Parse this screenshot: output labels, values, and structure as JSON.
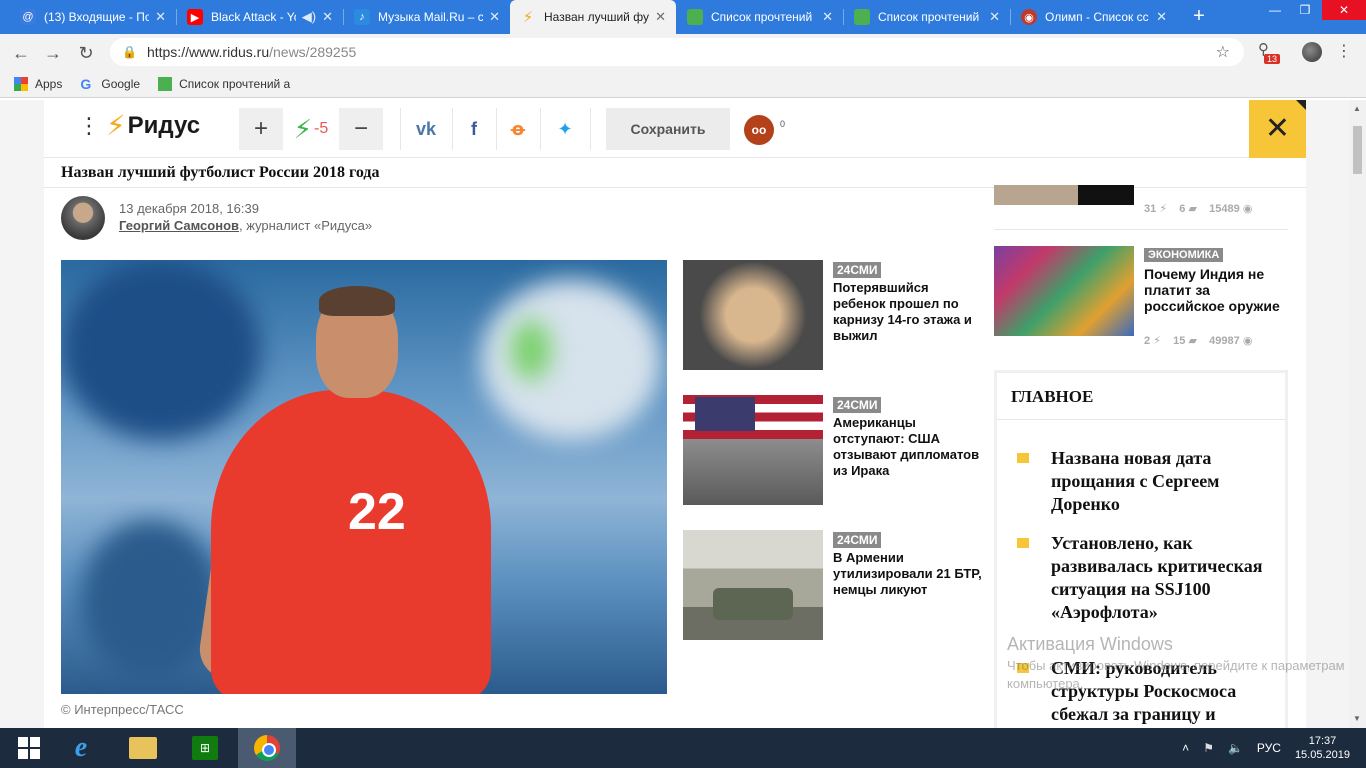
{
  "browser": {
    "tabs": [
      {
        "title": "(13) Входящие - По",
        "icon": "mail-ru-icon",
        "color": "#3a7be0",
        "active": false
      },
      {
        "title": "Black Attack - Yo",
        "icon": "youtube-icon",
        "color": "#ff0000",
        "active": false
      },
      {
        "title": "Музыка Mail.Ru – с",
        "icon": "mail-music-icon",
        "color": "#2a8be0",
        "active": false
      },
      {
        "title": "Назван лучший фу",
        "icon": "ridus-bolt-icon",
        "color": "#f7a81b",
        "active": true
      },
      {
        "title": "Список прочтений",
        "icon": "green-square-icon",
        "color": "#4caf50",
        "active": false
      },
      {
        "title": "Список прочтений",
        "icon": "green-square-icon",
        "color": "#4caf50",
        "active": false
      },
      {
        "title": "Олимп - Список сс",
        "icon": "olimp-icon",
        "color": "#c0392b",
        "active": false
      }
    ],
    "new_tab_label": "+",
    "window_controls": {
      "minimize": "—",
      "restore": "❐",
      "close": "✕"
    },
    "url_host": "https://www.ridus.ru",
    "url_path": "/news/289255",
    "extension_badge": "13",
    "bookmarks": [
      {
        "label": "Apps",
        "icon": "apps-grid-icon"
      },
      {
        "label": "Google",
        "icon": "google-icon"
      },
      {
        "label": "Список прочтений а",
        "icon": "green-square-icon"
      }
    ]
  },
  "site": {
    "logo_text": "Ридус",
    "rating_plus": "+",
    "rating_minus": "−",
    "rating_value": "-5",
    "share_vk": "vk",
    "share_fb": "f",
    "share_ok": "ok",
    "share_tw": "tw",
    "save_label": "Сохранить",
    "glasses_count": "0",
    "close_label": "✕"
  },
  "article": {
    "title": "Назван лучший футболист России 2018 года",
    "date": "13 декабря 2018, 16:39",
    "author": "Георгий Самсонов",
    "author_role": ", журналист «Ридуса»",
    "shirt_number": "22",
    "photo_credit": "© Интерпресс/ТАСС"
  },
  "related": [
    {
      "tag": "24СМИ",
      "title": "Потерявшийся ребенок прошел по карнизу 14-го этажа и выжил"
    },
    {
      "tag": "24СМИ",
      "title": "Американцы отступают: США отзывают дипломатов из Ирака"
    },
    {
      "tag": "24СМИ",
      "title": "В Армении утилизировали 21 БТР, немцы ликуют"
    }
  ],
  "sidebar": {
    "top_stats": {
      "bolts": "31",
      "comments": "6",
      "views": "15489"
    },
    "item": {
      "tag": "ЭКОНОМИКА",
      "title": "Почему Индия не платит за российское оружие",
      "bolts": "2",
      "comments": "15",
      "views": "49987"
    },
    "main_box": {
      "title": "ГЛАВНОЕ",
      "items": [
        "Названа новая дата прощания с Сергеем Доренко",
        "Установлено, как развивалась критическая ситуация на SSJ100 «Аэрофлота»",
        "СМИ: руководитель структуры Роскосмоса сбежал за границу и"
      ]
    }
  },
  "watermark": {
    "line1": "Активация Windows",
    "line2": "Чтобы активировать Windows, перейдите к параметрам компьютера."
  },
  "taskbar": {
    "language": "РУС",
    "time": "17:37",
    "date": "15.05.2019"
  }
}
